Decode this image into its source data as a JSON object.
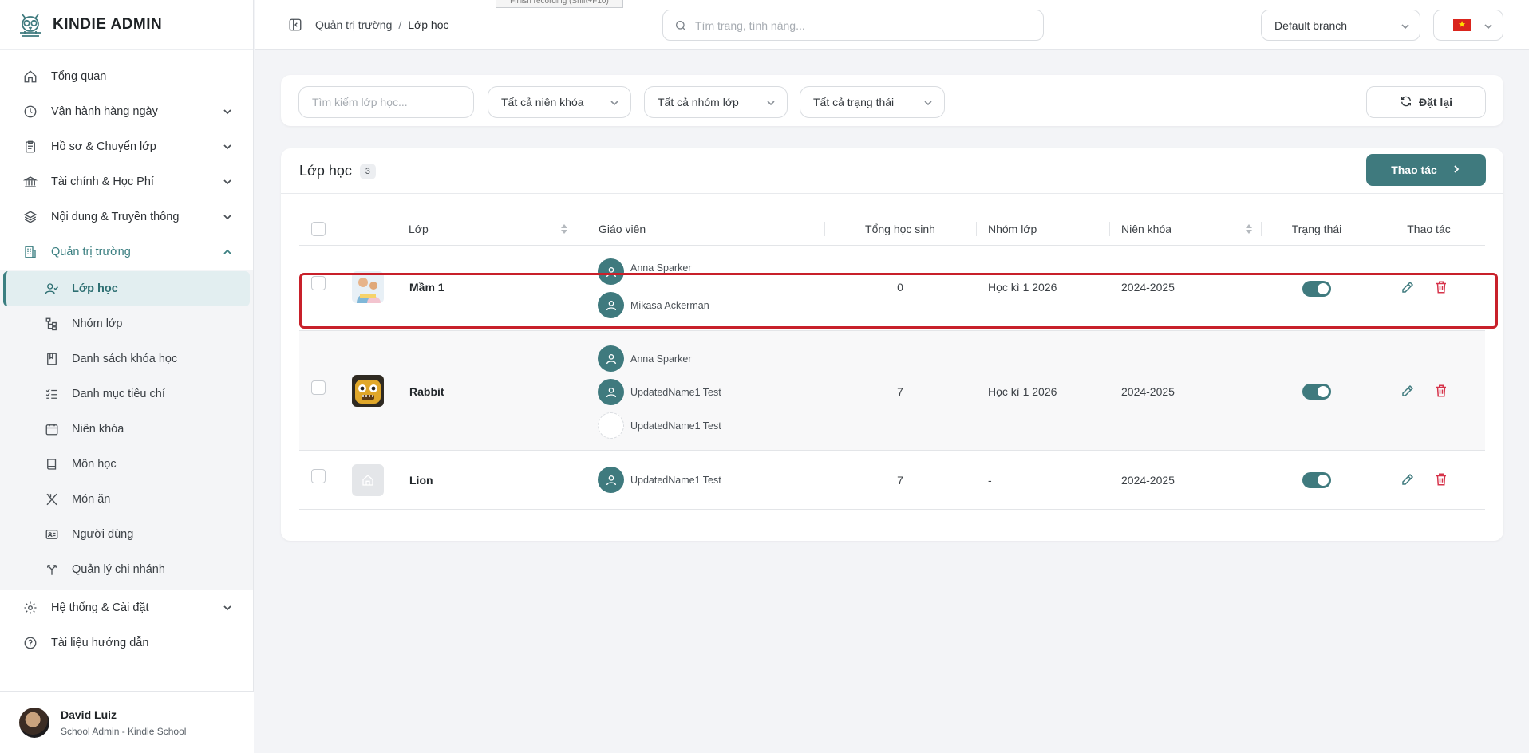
{
  "app": {
    "title": "KINDIE ADMIN"
  },
  "sidebar": {
    "items": [
      {
        "label": "Tổng quan"
      },
      {
        "label": "Vận hành hàng ngày"
      },
      {
        "label": "Hồ sơ & Chuyển lớp"
      },
      {
        "label": "Tài chính & Học Phí"
      },
      {
        "label": "Nội dung & Truyền thông"
      },
      {
        "label": "Quản trị trường"
      }
    ],
    "subitems": [
      {
        "label": "Lớp học"
      },
      {
        "label": "Nhóm lớp"
      },
      {
        "label": "Danh sách khóa học"
      },
      {
        "label": "Danh mục tiêu chí"
      },
      {
        "label": "Niên khóa"
      },
      {
        "label": "Môn học"
      },
      {
        "label": "Món ăn"
      },
      {
        "label": "Người dùng"
      },
      {
        "label": "Quản lý chi nhánh"
      }
    ],
    "bottom_items": [
      {
        "label": "Hệ thống & Cài đặt"
      },
      {
        "label": "Tài liệu hướng dẫn"
      }
    ],
    "user": {
      "name": "David Luiz",
      "role": "School Admin - Kindie School"
    }
  },
  "header": {
    "breadcrumb": [
      "Quản trị trường",
      "/",
      "Lớp học"
    ],
    "recording_tip": "Finish recording (Shift+F10)",
    "search_placeholder": "Tìm trang, tính năng...",
    "branch": "Default branch",
    "flag_star": "★"
  },
  "filters": {
    "search_placeholder": "Tìm kiếm lớp học...",
    "year": "Tất cả niên khóa",
    "group": "Tất cả nhóm lớp",
    "status": "Tất cả trạng thái",
    "reset_label": "Đặt lại"
  },
  "table": {
    "title": "Lớp học",
    "count": "3",
    "action_label": "Thao tác",
    "columns": {
      "class": "Lớp",
      "teacher": "Giáo viên",
      "students": "Tổng học sinh",
      "group": "Nhóm lớp",
      "year": "Niên khóa",
      "status": "Trạng thái",
      "actions": "Thao tác"
    },
    "rows": [
      {
        "name": "Mầm 1",
        "teachers": [
          "Anna Sparker",
          "Mikasa Ackerman"
        ],
        "students": "0",
        "group": "Học kì 1 2026",
        "year": "2024-2025",
        "active": true
      },
      {
        "name": "Rabbit",
        "teachers": [
          "Anna Sparker",
          "UpdatedName1 Test",
          "UpdatedName1 Test"
        ],
        "students": "7",
        "group": "Học kì 1 2026",
        "year": "2024-2025",
        "active": true
      },
      {
        "name": "Lion",
        "teachers": [
          "UpdatedName1 Test"
        ],
        "students": "7",
        "group": "-",
        "year": "2024-2025",
        "active": true
      }
    ]
  },
  "colors": {
    "accent": "#3f7a7e",
    "danger": "#d6334a",
    "highlight": "#c8202a"
  }
}
